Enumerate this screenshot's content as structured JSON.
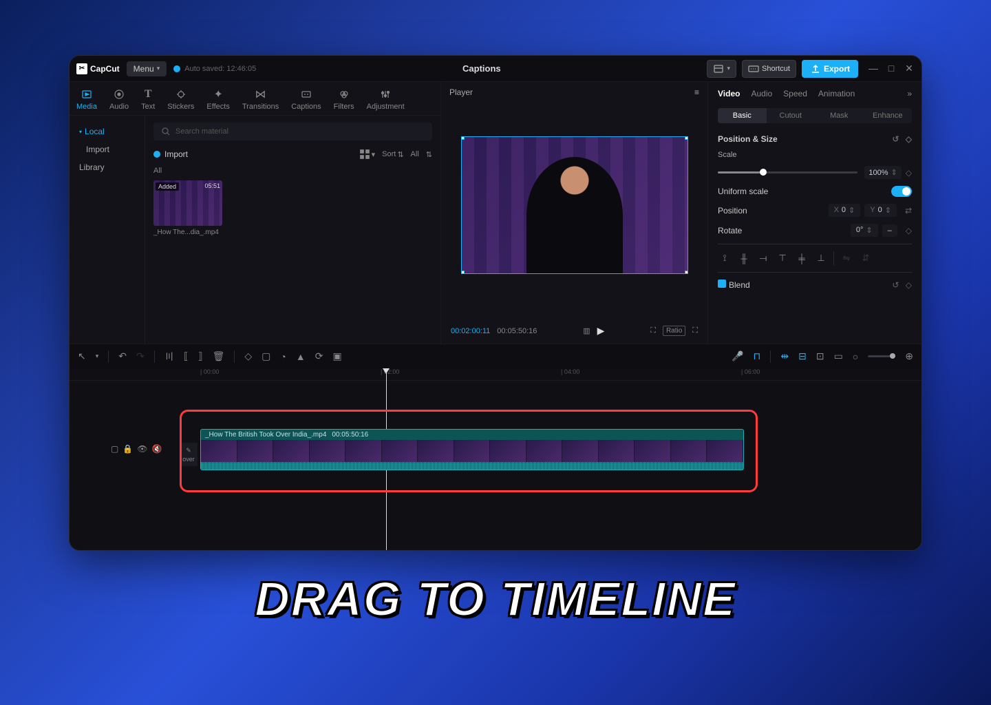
{
  "app": {
    "name": "CapCut"
  },
  "topbar": {
    "menu": "Menu",
    "autosave": "Auto saved: 12:46:05",
    "center_title": "Captions",
    "shortcut": "Shortcut",
    "export": "Export"
  },
  "left_tabs": [
    {
      "label": "Media",
      "icon": "▶"
    },
    {
      "label": "Audio",
      "icon": "◑"
    },
    {
      "label": "Text",
      "icon": "T"
    },
    {
      "label": "Stickers",
      "icon": "☾"
    },
    {
      "label": "Effects",
      "icon": "✦"
    },
    {
      "label": "Transitions",
      "icon": "⋈"
    },
    {
      "label": "Captions",
      "icon": "▭"
    },
    {
      "label": "Filters",
      "icon": "❀"
    },
    {
      "label": "Adjustment",
      "icon": "⚙"
    }
  ],
  "left_side": {
    "local": "Local",
    "import": "Import",
    "library": "Library"
  },
  "left_main": {
    "search_placeholder": "Search material",
    "import_label": "Import",
    "sort": "Sort",
    "all": "All",
    "section_all": "All"
  },
  "media_item": {
    "badge": "Added",
    "duration": "05:51",
    "name": "_How The...dia_.mp4"
  },
  "player": {
    "title": "Player",
    "current": "00:02:00:11",
    "total": "00:05:50:16",
    "ratio": "Ratio"
  },
  "right_tabs": {
    "video": "Video",
    "audio": "Audio",
    "speed": "Speed",
    "animation": "Animation"
  },
  "subtabs": {
    "basic": "Basic",
    "cutout": "Cutout",
    "mask": "Mask",
    "enhance": "Enhance"
  },
  "props": {
    "pos_size": "Position & Size",
    "scale": "Scale",
    "scale_val": "100%",
    "uniform": "Uniform scale",
    "position": "Position",
    "x_label": "X",
    "x_val": "0",
    "y_label": "Y",
    "y_val": "0",
    "rotate": "Rotate",
    "rotate_val": "0°",
    "blend": "Blend"
  },
  "ruler": {
    "t0": "| 00:00",
    "t1": "| 02:00",
    "t2": "| 04:00",
    "t3": "| 06:00"
  },
  "clip": {
    "name": "_How The British Took Over India_.mp4",
    "duration": "00:05:50:16"
  },
  "cover": "over",
  "caption": "DRAG TO TIMELINE"
}
